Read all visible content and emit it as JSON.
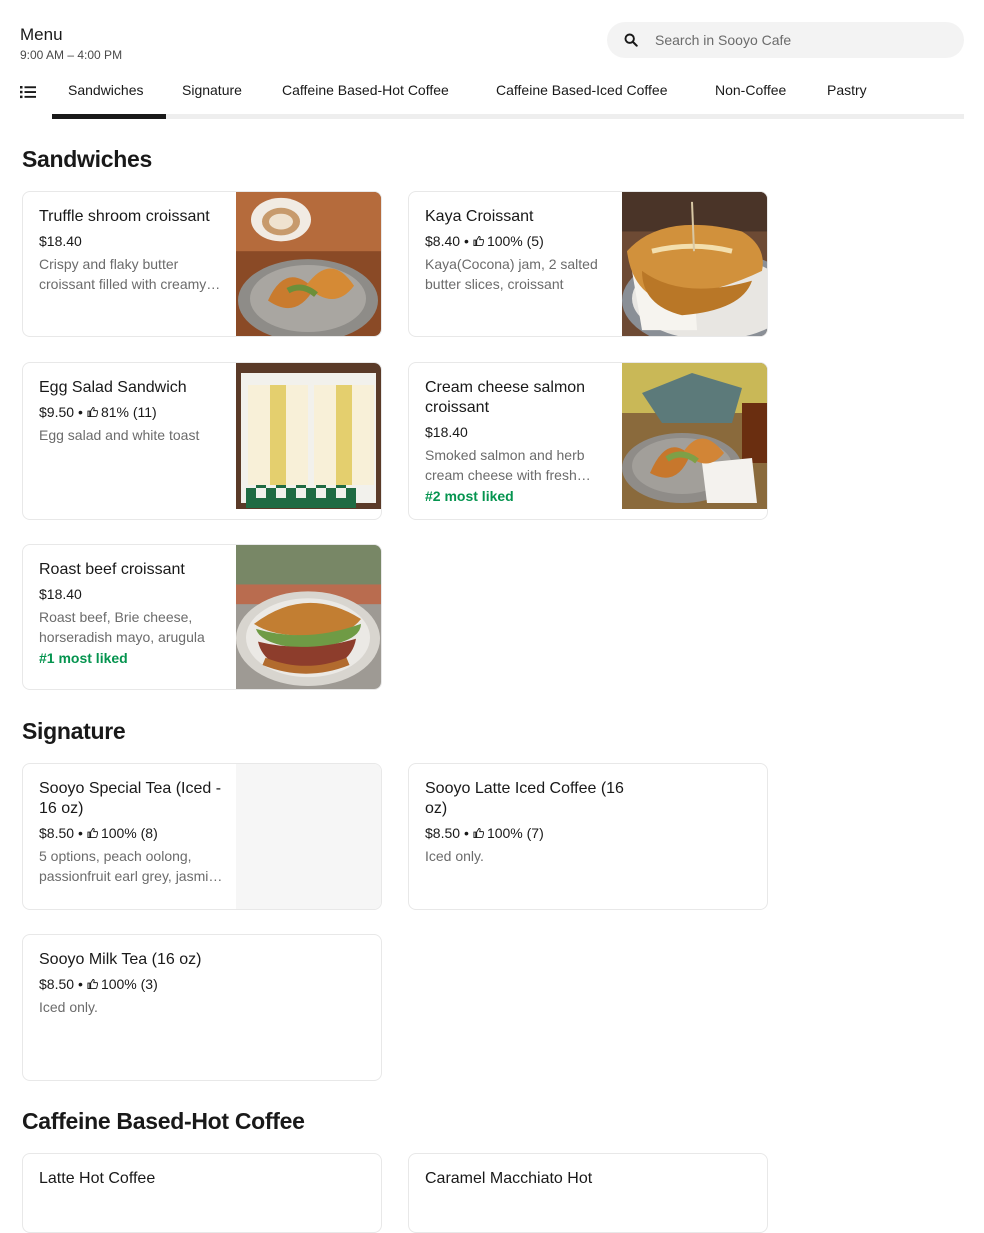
{
  "header": {
    "title": "Menu",
    "hours": "9:00 AM – 4:00 PM"
  },
  "search": {
    "placeholder": "Search in Sooyo Cafe",
    "value": ""
  },
  "tabs": [
    {
      "label": "Sandwiches",
      "active": true
    },
    {
      "label": "Signature"
    },
    {
      "label": "Caffeine Based-Hot Coffee"
    },
    {
      "label": "Caffeine Based-Iced Coffee"
    },
    {
      "label": "Non-Coffee"
    },
    {
      "label": "Pastry"
    }
  ],
  "sections": {
    "sandwiches": {
      "title": "Sandwiches",
      "items": [
        {
          "name": "Truffle shroom croissant",
          "price": "$18.40",
          "description": "Crispy and flaky butter croissant filled with creamy truffle mushroom",
          "image": "truffle-croissant-photo"
        },
        {
          "name": "Kaya Croissant",
          "price": "$8.40",
          "rating": "100% (5)",
          "description": "Kaya(Cocona) jam, 2 salted butter slices, croissant",
          "image": "kaya-croissant-photo"
        },
        {
          "name": "Egg Salad Sandwich",
          "price": "$9.50",
          "rating": "81% (11)",
          "description": "Egg salad and white toast",
          "image": "egg-sandwich-photo"
        },
        {
          "name": "Cream cheese salmon croissant",
          "price": "$18.40",
          "description": "Smoked salmon and herb cream cheese with fresh greens",
          "badge": "#2 most liked",
          "image": "salmon-croissant-photo"
        },
        {
          "name": "Roast beef croissant",
          "price": "$18.40",
          "description": "Roast beef, Brie cheese, horseradish mayo, arugula",
          "badge": "#1 most liked",
          "image": "roast-beef-croissant-photo"
        }
      ]
    },
    "signature": {
      "title": "Signature",
      "items": [
        {
          "name": "Sooyo Special Tea (Iced - 16 oz)",
          "price": "$8.50",
          "rating": "100% (8)",
          "description": "5 options, peach oolong, passionfruit earl grey, jasmine green",
          "image": "placeholder"
        },
        {
          "name": "Sooyo Latte Iced Coffee (16 oz)",
          "price": "$8.50",
          "rating": "100% (7)",
          "description": "Iced only."
        },
        {
          "name": "Sooyo Milk Tea (16 oz)",
          "price": "$8.50",
          "rating": "100% (3)",
          "description": "Iced only."
        }
      ]
    },
    "hot_coffee": {
      "title": "Caffeine Based-Hot Coffee",
      "items": [
        {
          "name": "Latte Hot Coffee"
        },
        {
          "name": "Caramel Macchiato Hot"
        }
      ]
    }
  },
  "colors": {
    "badge": "#05944f",
    "text": "#191919",
    "muted": "#6b6b6b",
    "search_bg": "#f3f3f3"
  },
  "icons": {
    "search": "search-icon",
    "menu_list": "list-icon",
    "rating": "thumbs-up-icon"
  }
}
